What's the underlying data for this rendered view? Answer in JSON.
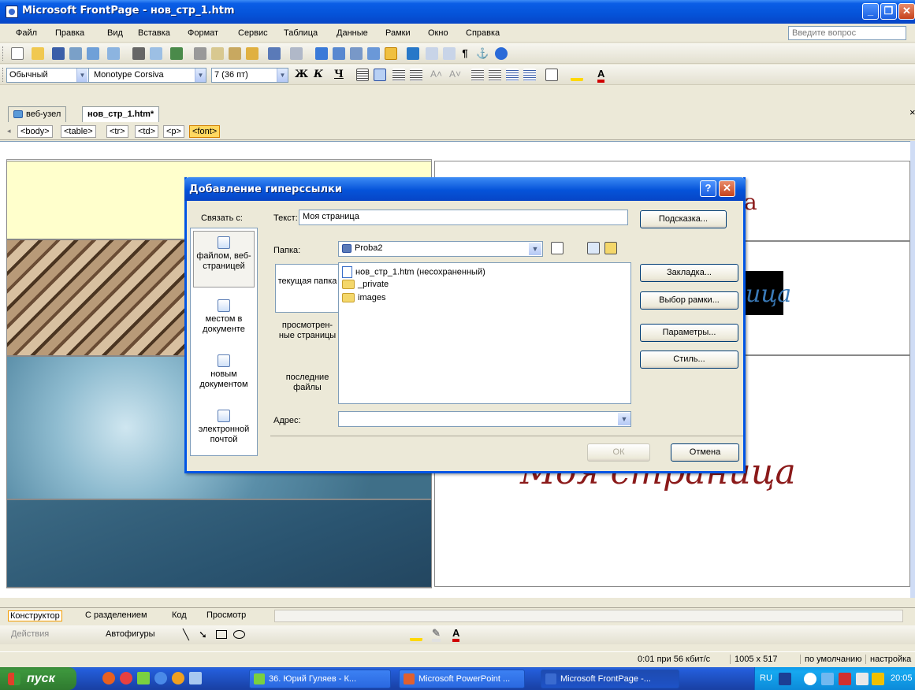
{
  "window": {
    "title": "Microsoft FrontPage - нов_стр_1.htm"
  },
  "menubar": {
    "items": [
      "Файл",
      "Правка",
      "Вид",
      "Вставка",
      "Формат",
      "Сервис",
      "Таблица",
      "Данные",
      "Рамки",
      "Окно",
      "Справка"
    ],
    "help_placeholder": "Введите вопрос"
  },
  "format_toolbar": {
    "style": "Обычный",
    "font": "Monotype Corsiva",
    "size": "7 (36 пт)"
  },
  "tabs": [
    "веб-узел",
    "нов_стр_1.htm*"
  ],
  "tag_selector": [
    "<body>",
    "<table>",
    "<tr>",
    "<td>",
    "<p>",
    "<font>"
  ],
  "page_preview": {
    "text_1": "а",
    "text_2": "ица",
    "text_3": "Моя страница",
    "colors": {
      "heading": "#8b1a1a",
      "cell_yellow": "#ffffcc"
    }
  },
  "dialog": {
    "title": "Добавление гиперссылки",
    "link_to_label": "Связать с:",
    "link_options": [
      "файлом, веб-страницей",
      "местом в документе",
      "новым документом",
      "электронной почтой"
    ],
    "text_label": "Текст:",
    "text_value": "Моя страница",
    "folder_label": "Папка:",
    "folder_value": "Proba2",
    "folder_tabs": [
      "текущая папка",
      "просмотрен-ные страницы",
      "последние файлы"
    ],
    "files": [
      "нов_стр_1.htm (несохраненный)",
      "_private",
      "images"
    ],
    "address_label": "Адрес:",
    "address_value": "",
    "buttons": {
      "screentip": "Подсказка...",
      "bookmark": "Закладка...",
      "target_frame": "Выбор рамки...",
      "parameters": "Параметры...",
      "style": "Стиль...",
      "ok": "ОК",
      "cancel": "Отмена"
    }
  },
  "view_tabs": [
    "Конструктор",
    "С разделением",
    "Код",
    "Просмотр"
  ],
  "drawing_toolbar": {
    "actions": "Действия",
    "autoshapes": "Автофигуры"
  },
  "statusbar": [
    "0:01 при 56 кбит/с",
    "1005 x 517",
    "по умолчанию",
    "настройка"
  ],
  "taskbar": {
    "start": "пуск",
    "tasks": [
      "36. Юрий Гуляев - К...",
      "Microsoft PowerPoint ...",
      "Microsoft FrontPage -..."
    ],
    "lang": "RU",
    "time": "20:05"
  }
}
